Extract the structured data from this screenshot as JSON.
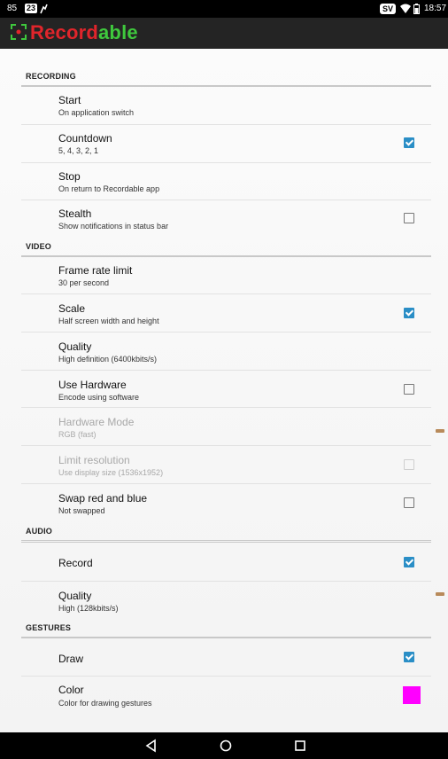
{
  "status_bar": {
    "left_number": "85",
    "badge": "23",
    "language": "SV",
    "time": "18:57"
  },
  "app": {
    "title_part1": "Record",
    "title_part2": "able",
    "logo_icon": "recordable-logo-icon",
    "accent_red": "#e0252b",
    "accent_green": "#3fc83d"
  },
  "categories": {
    "recording": "RECORDING",
    "video": "VIDEO",
    "audio": "AUDIO",
    "gestures": "GESTURES"
  },
  "prefs": {
    "start": {
      "title": "Start",
      "summary": "On application switch"
    },
    "countdown": {
      "title": "Countdown",
      "summary": "5, 4, 3, 2, 1",
      "checked": true
    },
    "stop": {
      "title": "Stop",
      "summary": "On return to Recordable app"
    },
    "stealth": {
      "title": "Stealth",
      "summary": "Show notifications in status bar",
      "checked": false
    },
    "frame_rate": {
      "title": "Frame rate limit",
      "summary": "30 per second"
    },
    "scale": {
      "title": "Scale",
      "summary": "Half screen width and height",
      "checked": true
    },
    "video_quality": {
      "title": "Quality",
      "summary": "High definition (6400kbits/s)"
    },
    "use_hardware": {
      "title": "Use Hardware",
      "summary": "Encode using software",
      "checked": false
    },
    "hardware_mode": {
      "title": "Hardware Mode",
      "summary": "RGB (fast)",
      "enabled": false
    },
    "limit_resolution": {
      "title": "Limit resolution",
      "summary": "Use display size (1536x1952)",
      "enabled": false,
      "checked": false
    },
    "swap_red_blue": {
      "title": "Swap red and blue",
      "summary": "Not swapped",
      "checked": false
    },
    "record": {
      "title": "Record",
      "checked": true
    },
    "audio_quality": {
      "title": "Quality",
      "summary": "High (128kbits/s)"
    },
    "draw": {
      "title": "Draw",
      "checked": true
    },
    "color": {
      "title": "Color",
      "summary": "Color for drawing gestures",
      "swatch": "#ff00ff"
    }
  },
  "nav_bar": {
    "back_icon": "back-triangle-icon",
    "home_icon": "home-circle-icon",
    "recents_icon": "recents-square-icon"
  }
}
